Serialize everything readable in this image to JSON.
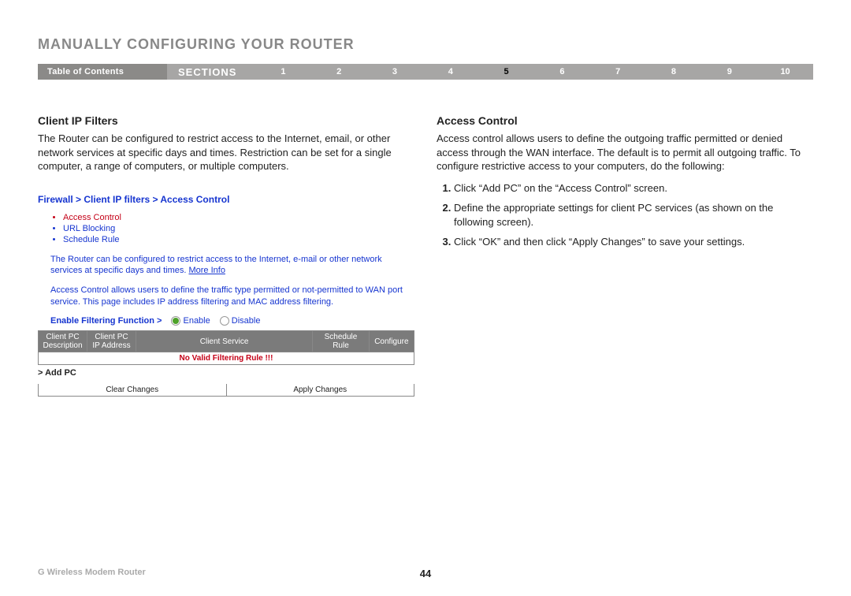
{
  "header": {
    "title": "MANUALLY CONFIGURING YOUR ROUTER"
  },
  "nav": {
    "toc": "Table of Contents",
    "sections": "SECTIONS",
    "items": [
      "1",
      "2",
      "3",
      "4",
      "5",
      "6",
      "7",
      "8",
      "9",
      "10"
    ],
    "current": "5"
  },
  "left": {
    "heading": "Client IP Filters",
    "body": "The Router can be configured to restrict access to the Internet, email, or other network services at specific days and times. Restriction can be set for a single computer, a range of computers, or multiple computers.",
    "shot": {
      "breadcrumb": "Firewall > Client IP filters > Access Control",
      "menu": {
        "access_control": "Access Control",
        "url_blocking": "URL Blocking",
        "schedule_rule": "Schedule Rule"
      },
      "desc1": "The Router can be configured to restrict access to the Internet, e-mail or other network services at specific days and times. ",
      "more": "More Info",
      "desc2": "Access Control allows users to define the traffic type permitted or not-permitted to WAN port service. This page includes IP address filtering and MAC address filtering.",
      "enable_label": "Enable Filtering Function >",
      "enable_opt": "Enable",
      "disable_opt": "Disable",
      "cols": {
        "c1": "Client PC Description",
        "c2": "Client PC IP Address",
        "c3": "Client Service",
        "c4": "Schedule Rule",
        "c5": "Configure"
      },
      "no_valid": "No Valid Filtering Rule !!!",
      "add_pc": "> Add PC",
      "clear": "Clear Changes",
      "apply": "Apply Changes"
    }
  },
  "right": {
    "heading": "Access Control",
    "body": "Access control allows users to define the outgoing traffic permitted or denied access through the WAN interface. The default is to permit all outgoing traffic. To configure restrictive access to your computers, do the following:",
    "steps": [
      "Click “Add PC” on the “Access Control” screen.",
      "Define the appropriate settings for client PC services (as shown on the following screen).",
      "Click “OK” and then click “Apply Changes” to save your settings."
    ]
  },
  "footer": {
    "product": "G Wireless Modem Router",
    "page": "44"
  }
}
